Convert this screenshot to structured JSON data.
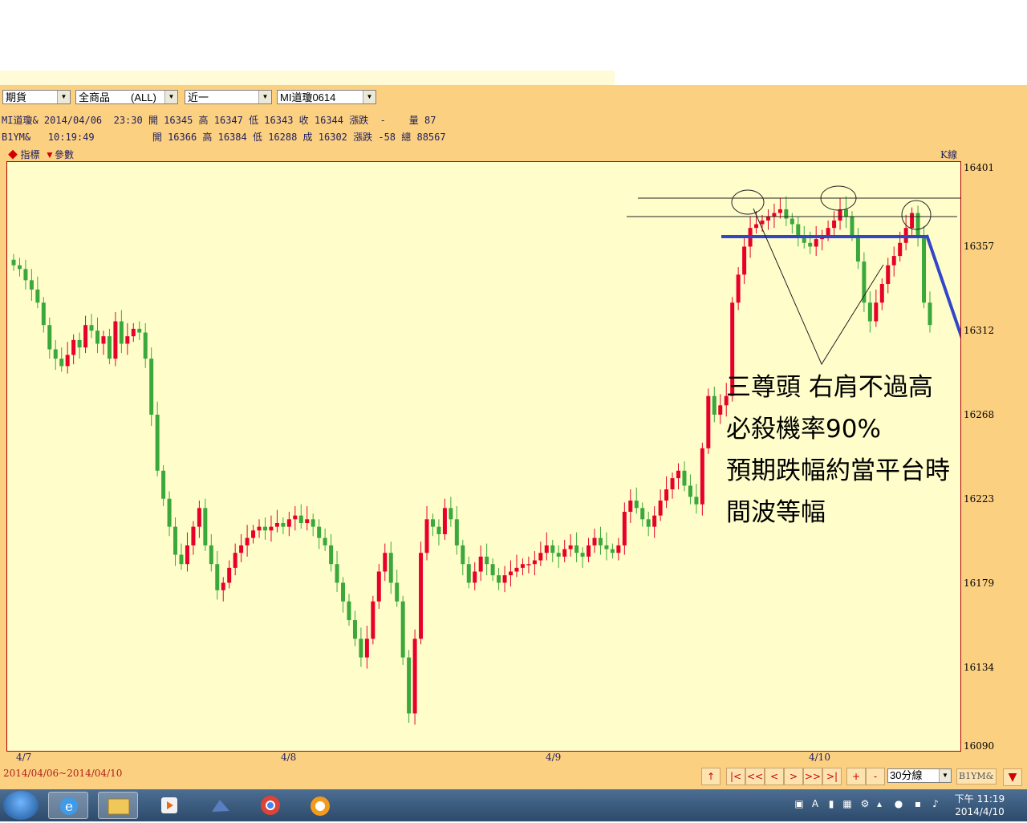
{
  "toolbar": {
    "market": "期貨",
    "product": "全商品　　(ALL)",
    "range": "近一",
    "symbol": "MI道瓊0614"
  },
  "quotes": [
    "MI道瓊& 2014/04/06  23:30 開 16345 高 16347 低 16343 收 16344 漲跌  -    量 87",
    "B1YM&   10:19:49          開 16366 高 16384 低 16288 成 16302 漲跌 -58 總 88567"
  ],
  "tools": {
    "indicator": "指標",
    "params": "參數"
  },
  "chart_title": "K線",
  "chart_data": {
    "type": "candlestick",
    "y_ticks": [
      16401,
      16357,
      16312,
      16268,
      16223,
      16179,
      16134,
      16090
    ],
    "ylim": [
      16090,
      16401
    ],
    "x_ticks": [
      "4/7",
      "4/8",
      "4/9",
      "4/10"
    ],
    "date_range": "2014/04/06~2014/04/10",
    "up_color": "#e8002a",
    "down_color": "#3aa83a",
    "annotation": [
      "三尊頭 右肩不過高",
      "必殺機率90%",
      "預期跌幅約當平台時",
      "間波等幅"
    ]
  },
  "nav": [
    "↑",
    "|<",
    "<<",
    "<",
    ">",
    ">>",
    ">|",
    "+",
    "-"
  ],
  "period": "30分線",
  "nav_symbol": "B1YM&",
  "taskbar": {
    "time": "下午 11:19",
    "date": "2014/4/10"
  }
}
